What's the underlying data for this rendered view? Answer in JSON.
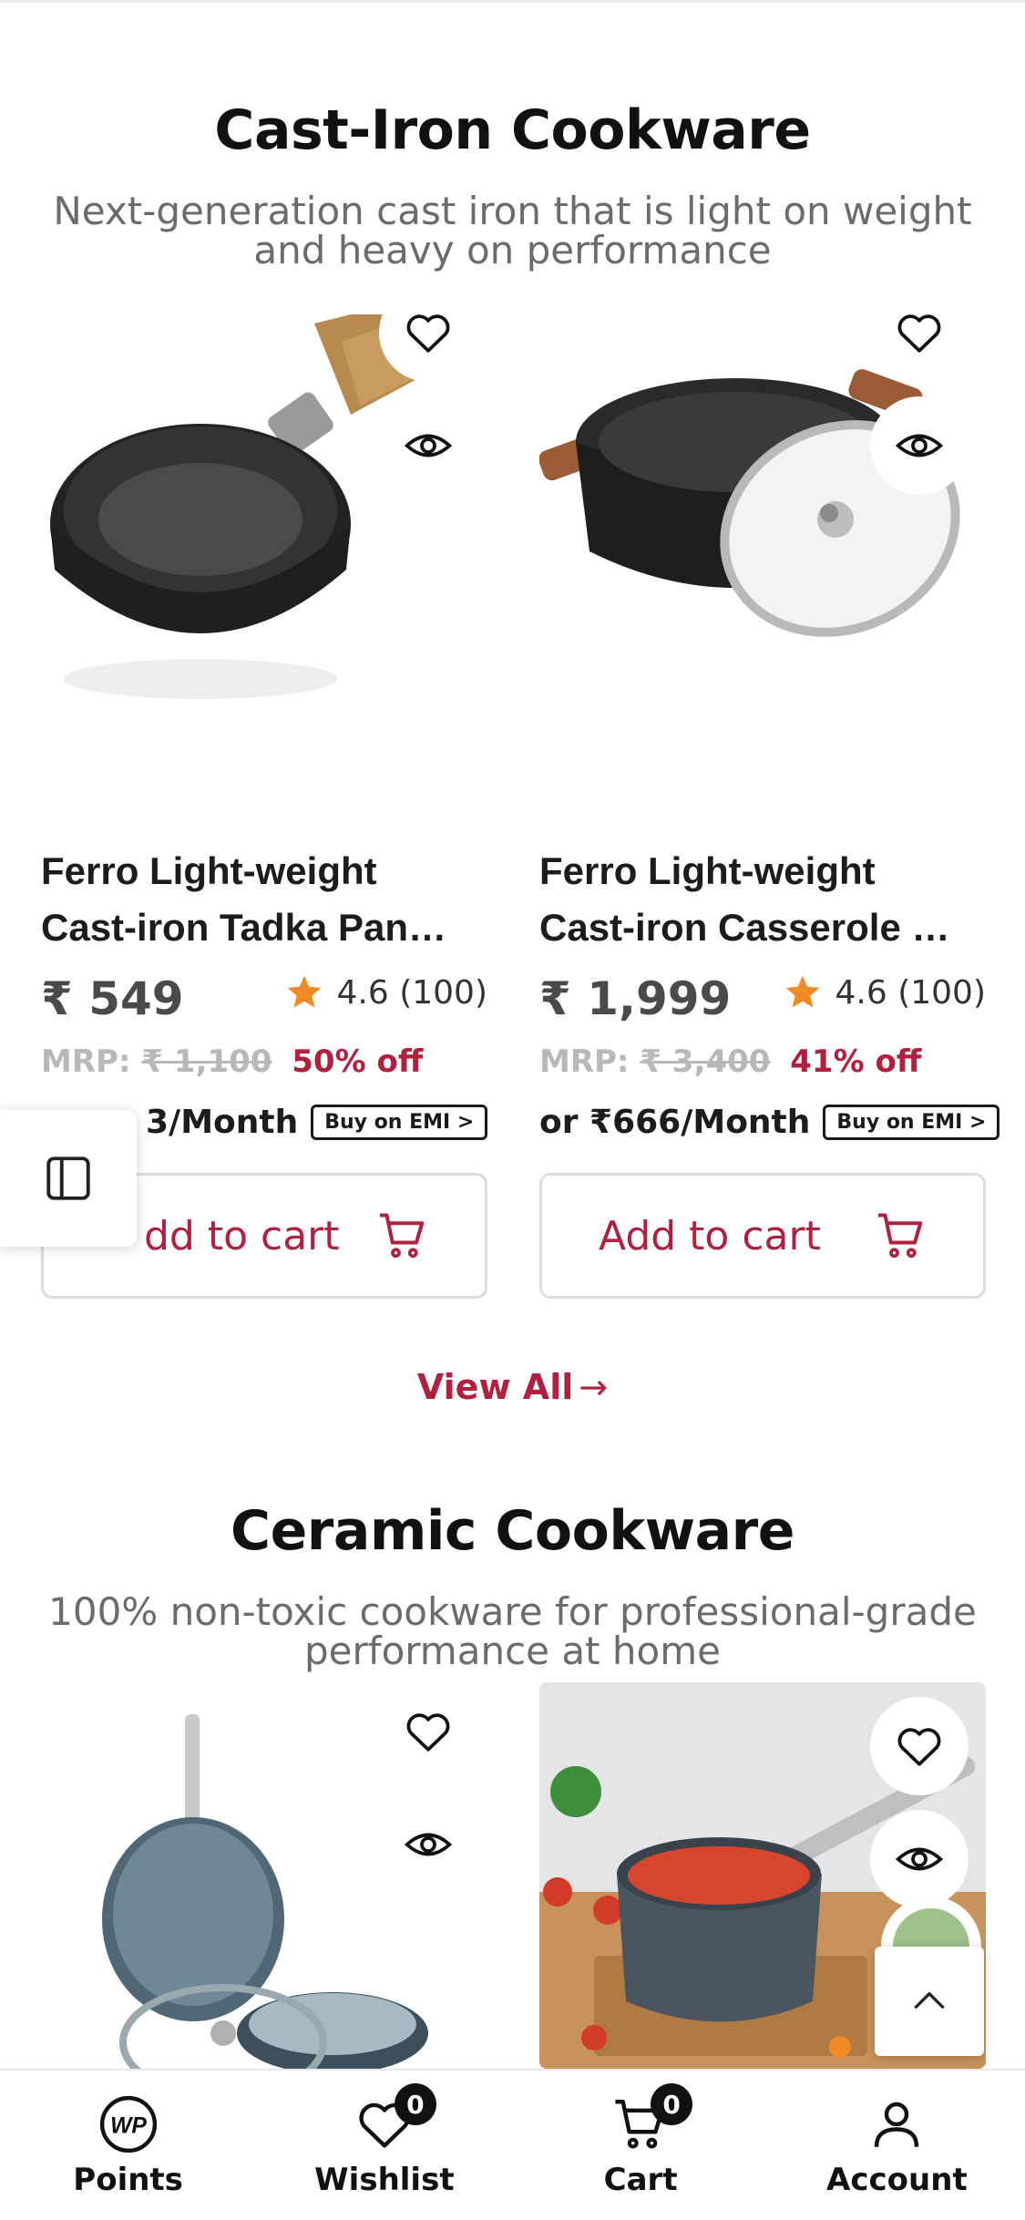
{
  "sections": [
    {
      "title": "Cast-Iron Cookware",
      "subtitle_line1": "Next-generation cast iron that is light on weight",
      "subtitle_line2": "and heavy on performance",
      "view_all": "View All",
      "products": [
        {
          "name_line1": "Ferro Light-weight",
          "name_line2": "Cast-iron Tadka Pan…",
          "price": "₹ 549",
          "rating": "4.6 (100)",
          "mrp_label": "MRP:",
          "mrp_value": "₹ 1,100",
          "discount": "50% off",
          "emi_text": "3/Month",
          "emi_button": "Buy on EMI >",
          "add_to_cart": "dd to cart"
        },
        {
          "name_line1": "Ferro Light-weight",
          "name_line2": "Cast-iron Casserole …",
          "price": "₹ 1,999",
          "rating": "4.6 (100)",
          "mrp_label": "MRP:",
          "mrp_value": "₹ 3,400",
          "discount": "41% off",
          "emi_text": "or ₹666/Month",
          "emi_button": "Buy on EMI >",
          "add_to_cart": "Add to cart"
        }
      ]
    },
    {
      "title": "Ceramic Cookware",
      "subtitle_line1": "100% non-toxic cookware for professional-grade",
      "subtitle_line2": "performance at home"
    }
  ],
  "icons": {
    "wishlist": "heart-icon",
    "quick_view": "eye-icon",
    "rating": "star-icon",
    "cart": "cart-icon",
    "sidebar": "sidebar-panel-icon",
    "scroll_top": "chevron-up-icon"
  },
  "colors": {
    "accent": "#b1203e",
    "star": "#f08a24",
    "muted": "#b8b8b8"
  },
  "bottom_nav": [
    {
      "label": "Points",
      "icon": "wp-points-icon"
    },
    {
      "label": "Wishlist",
      "icon": "heart-icon",
      "badge": "0"
    },
    {
      "label": "Cart",
      "icon": "cart-icon",
      "badge": "0"
    },
    {
      "label": "Account",
      "icon": "user-icon"
    }
  ],
  "points_logo_text": "WP"
}
